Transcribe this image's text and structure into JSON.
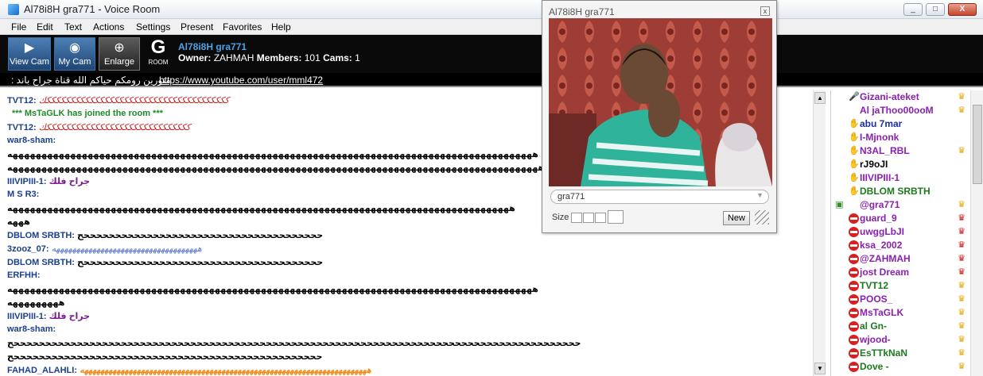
{
  "window": {
    "title": "Al78i8H gra771 - Voice Room",
    "controls": [
      "_",
      "□",
      "X"
    ]
  },
  "menu": [
    "File",
    "Edit",
    "Text",
    "Actions",
    "Settings",
    "Present",
    "Favorites",
    "Help"
  ],
  "toolbar": {
    "view_cam": "View Cam",
    "my_cam": "My Cam",
    "enlarge": "Enlarge",
    "logo_letter": "G",
    "logo_sub": "ROOM",
    "room_name": "Al78i8H gra771",
    "owner_label": "Owner:",
    "owner": "ZAHMAH",
    "members_label": "Members:",
    "members": "101",
    "cams_label": "Cams:",
    "cams": "1"
  },
  "topic": {
    "arabic": "منورين رومكم حياكم الله  قناة جراح باند :",
    "link": "https://www.youtube.com/user/mml472"
  },
  "chat": [
    {
      "nick": "TVT12:",
      "text": "ككككككككككككككككككككككككككككككككككككككك",
      "style": "red"
    },
    {
      "nick": "",
      "text": "*** MsTaGLK has joined the room ***",
      "style": "sys"
    },
    {
      "nick": "TVT12:",
      "text": "ككككككككككككككككككككككككككككككك",
      "style": "red"
    },
    {
      "nick": "war8-sham:",
      "text": "",
      "style": "black"
    },
    {
      "nick": "",
      "text": "هههههههههههههههههههههههههههههههههههههههههههههههههههههههههههههههههههههههههههههههههههههههههههه",
      "style": "black"
    },
    {
      "nick": "",
      "text": "ههههههههههههههههههههههههههههههههههههههههههههههههههههههههههههههههههههههههههههههههههههههههههههه",
      "style": "black"
    },
    {
      "nick": "IIIVIPIII-1:",
      "text": "جراح فلك",
      "style": "purple"
    },
    {
      "nick": "M S R3:",
      "text": "",
      "style": "black"
    },
    {
      "nick": "",
      "text": "هههههههههههههههههههههههههههههههههههههههههههههههههههههههههههههههههههههههههههههههههههههههه",
      "style": "black"
    },
    {
      "nick": "",
      "text": "هههه",
      "style": "black"
    },
    {
      "nick": "DBLOM SRBTH:",
      "text": "ححححححححححححححححححححححححححححححححححححححح",
      "style": "black"
    },
    {
      "nick": "3zooz_07:",
      "text": "ههههههههههههههههههههههههههههههههههههه",
      "style": "blue"
    },
    {
      "nick": "DBLOM SRBTH:",
      "text": "ححححححححححححححححححححححححححححححححححححححح",
      "style": "black"
    },
    {
      "nick": "ERFHH:",
      "text": "",
      "style": "black"
    },
    {
      "nick": "",
      "text": "هههههههههههههههههههههههههههههههههههههههههههههههههههههههههههههههههههههههههههههههههههههههههههه",
      "style": "black"
    },
    {
      "nick": "",
      "text": "هههههههههه",
      "style": "black"
    },
    {
      "nick": "IIIVIPIII-1:",
      "text": "جراح فلك",
      "style": "purple"
    },
    {
      "nick": "war8-sham:",
      "text": "",
      "style": "black"
    },
    {
      "nick": "",
      "text": "ححححححححححححححححححححححححححححححححححححححححححححححححححححححححححححححححححححححححححححححححححححححححححح",
      "style": "black"
    },
    {
      "nick": "",
      "text": "حححححححححححححححححححححححححححححححححححححححححححححححححح",
      "style": "black"
    },
    {
      "nick": "FAHAD_ALAHLI:",
      "text": "هههههههههههههههههههههههههههههههههههههههههههههههههههههههههههههههههههههههه",
      "style": "orange"
    }
  ],
  "camera": {
    "title": "Al78i8H gra771",
    "close": "x",
    "field_value": "gra771",
    "size_label": "Size",
    "new_button": "New"
  },
  "users": [
    {
      "name": "Gizani-ateket",
      "color": "#8a1fb0",
      "icon": "mic-icon",
      "badge": "crown"
    },
    {
      "name": "Al jaThoo00ooM",
      "color": "#8a1fb0",
      "icon": "",
      "badge": "crown"
    },
    {
      "name": "abu 7mar",
      "color": "#1a2fa0",
      "icon": "hand-icon",
      "badge": ""
    },
    {
      "name": "I-Mjnonk",
      "color": "#8a1fb0",
      "icon": "hand-icon",
      "badge": ""
    },
    {
      "name": "N3AL_RBL",
      "color": "#8a1fb0",
      "icon": "hand-icon",
      "badge": "crown"
    },
    {
      "name": "rJ9oJI",
      "color": "#000000",
      "icon": "hand-icon",
      "badge": ""
    },
    {
      "name": "IIIVIPIII-1",
      "color": "#8a1fb0",
      "icon": "hand-icon",
      "badge": ""
    },
    {
      "name": "DBLOM SRBTH",
      "color": "#1d7a1d",
      "icon": "hand-icon",
      "badge": ""
    },
    {
      "name": "@gra771",
      "color": "#8a1fb0",
      "icon": "cam-icon",
      "badge": "crown"
    },
    {
      "name": "guard_9",
      "color": "#8a1fb0",
      "icon": "no-entry-icon",
      "badge": "redcrown"
    },
    {
      "name": "uwggLbJI",
      "color": "#8a1fb0",
      "icon": "no-entry-icon",
      "badge": "redcrown"
    },
    {
      "name": "ksa_2002",
      "color": "#8a1fb0",
      "icon": "no-entry-icon",
      "badge": "redcrown"
    },
    {
      "name": "@ZAHMAH",
      "color": "#8a1fb0",
      "icon": "no-entry-icon",
      "badge": "redcrown"
    },
    {
      "name": "jost Dream",
      "color": "#8a1fb0",
      "icon": "no-entry-icon",
      "badge": "redcrown"
    },
    {
      "name": "TVT12",
      "color": "#1d7a1d",
      "icon": "no-entry-icon",
      "badge": "crown"
    },
    {
      "name": "POOS_",
      "color": "#8a1fb0",
      "icon": "no-entry-icon",
      "badge": "crown"
    },
    {
      "name": "MsTaGLK",
      "color": "#8a1fb0",
      "icon": "no-entry-icon",
      "badge": "crown"
    },
    {
      "name": "al Gn-",
      "color": "#1d7a1d",
      "icon": "no-entry-icon",
      "badge": "crown"
    },
    {
      "name": "wjood-",
      "color": "#8a1fb0",
      "icon": "no-entry-icon",
      "badge": "crown"
    },
    {
      "name": "EsTTkNaN",
      "color": "#1d7a1d",
      "icon": "no-entry-icon",
      "badge": "crown"
    },
    {
      "name": "Dove -",
      "color": "#1d7a1d",
      "icon": "no-entry-icon",
      "badge": "crown"
    }
  ]
}
